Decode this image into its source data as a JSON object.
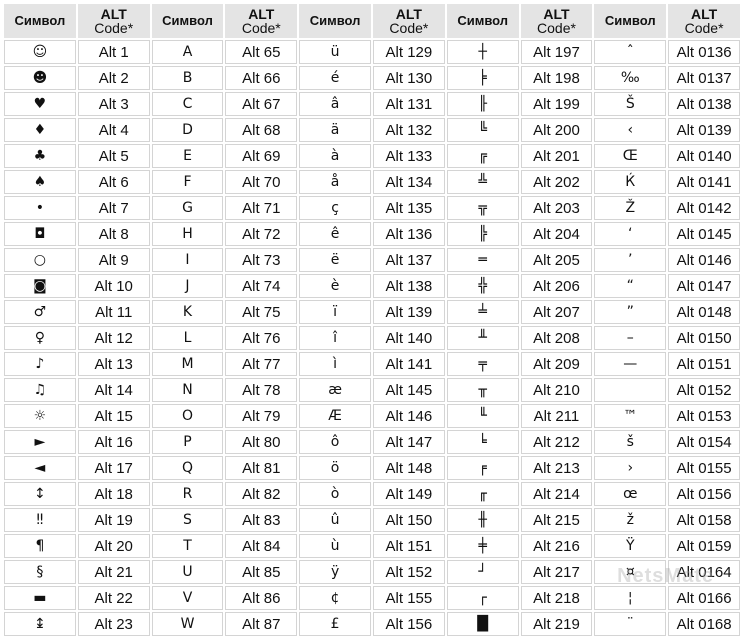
{
  "headers": {
    "symbol": "Символ",
    "code_line1": "ALT",
    "code_line2": "Code*"
  },
  "groups": [
    {
      "rows": [
        {
          "symbol": "☺",
          "code": "Alt 1"
        },
        {
          "symbol": "☻",
          "code": "Alt 2"
        },
        {
          "symbol": "♥",
          "code": "Alt 3"
        },
        {
          "symbol": "♦",
          "code": "Alt 4"
        },
        {
          "symbol": "♣",
          "code": "Alt 5"
        },
        {
          "symbol": "♠",
          "code": "Alt 6"
        },
        {
          "symbol": "•",
          "code": "Alt 7"
        },
        {
          "symbol": "◘",
          "code": "Alt 8"
        },
        {
          "symbol": "○",
          "code": "Alt 9"
        },
        {
          "symbol": "◙",
          "code": "Alt 10"
        },
        {
          "symbol": "♂",
          "code": "Alt 11"
        },
        {
          "symbol": "♀",
          "code": "Alt 12"
        },
        {
          "symbol": "♪",
          "code": "Alt 13"
        },
        {
          "symbol": "♫",
          "code": "Alt 14"
        },
        {
          "symbol": "☼",
          "code": "Alt 15"
        },
        {
          "symbol": "►",
          "code": "Alt 16"
        },
        {
          "symbol": "◄",
          "code": "Alt 17"
        },
        {
          "symbol": "↕",
          "code": "Alt 18"
        },
        {
          "symbol": "‼",
          "code": "Alt 19"
        },
        {
          "symbol": "¶",
          "code": "Alt 20"
        },
        {
          "symbol": "§",
          "code": "Alt 21"
        },
        {
          "symbol": "▬",
          "code": "Alt 22"
        },
        {
          "symbol": "↨",
          "code": "Alt 23"
        }
      ]
    },
    {
      "rows": [
        {
          "symbol": "A",
          "code": "Alt 65"
        },
        {
          "symbol": "B",
          "code": "Alt 66"
        },
        {
          "symbol": "C",
          "code": "Alt 67"
        },
        {
          "symbol": "D",
          "code": "Alt 68"
        },
        {
          "symbol": "E",
          "code": "Alt 69"
        },
        {
          "symbol": "F",
          "code": "Alt 70"
        },
        {
          "symbol": "G",
          "code": "Alt 71"
        },
        {
          "symbol": "H",
          "code": "Alt 72"
        },
        {
          "symbol": "I",
          "code": "Alt 73"
        },
        {
          "symbol": "J",
          "code": "Alt 74"
        },
        {
          "symbol": "K",
          "code": "Alt 75"
        },
        {
          "symbol": "L",
          "code": "Alt 76"
        },
        {
          "symbol": "M",
          "code": "Alt 77"
        },
        {
          "symbol": "N",
          "code": "Alt 78"
        },
        {
          "symbol": "O",
          "code": "Alt 79"
        },
        {
          "symbol": "P",
          "code": "Alt 80"
        },
        {
          "symbol": "Q",
          "code": "Alt 81"
        },
        {
          "symbol": "R",
          "code": "Alt 82"
        },
        {
          "symbol": "S",
          "code": "Alt 83"
        },
        {
          "symbol": "T",
          "code": "Alt 84"
        },
        {
          "symbol": "U",
          "code": "Alt 85"
        },
        {
          "symbol": "V",
          "code": "Alt 86"
        },
        {
          "symbol": "W",
          "code": "Alt 87"
        }
      ]
    },
    {
      "rows": [
        {
          "symbol": "ü",
          "code": "Alt 129"
        },
        {
          "symbol": "é",
          "code": "Alt 130"
        },
        {
          "symbol": "â",
          "code": "Alt 131"
        },
        {
          "symbol": "ä",
          "code": "Alt 132"
        },
        {
          "symbol": "à",
          "code": "Alt 133"
        },
        {
          "symbol": "å",
          "code": "Alt 134"
        },
        {
          "symbol": "ç",
          "code": "Alt 135"
        },
        {
          "symbol": "ê",
          "code": "Alt 136"
        },
        {
          "symbol": "ë",
          "code": "Alt 137"
        },
        {
          "symbol": "è",
          "code": "Alt 138"
        },
        {
          "symbol": "ï",
          "code": "Alt 139"
        },
        {
          "symbol": "î",
          "code": "Alt 140"
        },
        {
          "symbol": "ì",
          "code": "Alt 141"
        },
        {
          "symbol": "æ",
          "code": "Alt 145"
        },
        {
          "symbol": "Æ",
          "code": "Alt 146"
        },
        {
          "symbol": "ô",
          "code": "Alt 147"
        },
        {
          "symbol": "ö",
          "code": "Alt 148"
        },
        {
          "symbol": "ò",
          "code": "Alt 149"
        },
        {
          "symbol": "û",
          "code": "Alt 150"
        },
        {
          "symbol": "ù",
          "code": "Alt 151"
        },
        {
          "symbol": "ÿ",
          "code": "Alt 152"
        },
        {
          "symbol": "¢",
          "code": "Alt 155"
        },
        {
          "symbol": "£",
          "code": "Alt 156"
        }
      ]
    },
    {
      "rows": [
        {
          "symbol": "┼",
          "code": "Alt 197"
        },
        {
          "symbol": "╞",
          "code": "Alt 198"
        },
        {
          "symbol": "╟",
          "code": "Alt 199"
        },
        {
          "symbol": "╚",
          "code": "Alt 200"
        },
        {
          "symbol": "╔",
          "code": "Alt 201"
        },
        {
          "symbol": "╩",
          "code": "Alt 202"
        },
        {
          "symbol": "╦",
          "code": "Alt 203"
        },
        {
          "symbol": "╠",
          "code": "Alt 204"
        },
        {
          "symbol": "═",
          "code": "Alt 205"
        },
        {
          "symbol": "╬",
          "code": "Alt 206"
        },
        {
          "symbol": "╧",
          "code": "Alt 207"
        },
        {
          "symbol": "╨",
          "code": "Alt 208"
        },
        {
          "symbol": "╤",
          "code": "Alt 209"
        },
        {
          "symbol": "╥",
          "code": "Alt 210"
        },
        {
          "symbol": "╙",
          "code": "Alt 211"
        },
        {
          "symbol": "╘",
          "code": "Alt 212"
        },
        {
          "symbol": "╒",
          "code": "Alt 213"
        },
        {
          "symbol": "╓",
          "code": "Alt 214"
        },
        {
          "symbol": "╫",
          "code": "Alt 215"
        },
        {
          "symbol": "╪",
          "code": "Alt 216"
        },
        {
          "symbol": "┘",
          "code": "Alt 217"
        },
        {
          "symbol": "┌",
          "code": "Alt 218"
        },
        {
          "symbol": "█",
          "code": "Alt 219"
        }
      ]
    },
    {
      "rows": [
        {
          "symbol": "ˆ",
          "code": "Alt 0136"
        },
        {
          "symbol": "‰",
          "code": "Alt 0137"
        },
        {
          "symbol": "Š",
          "code": "Alt 0138"
        },
        {
          "symbol": "‹",
          "code": "Alt 0139"
        },
        {
          "symbol": "Œ",
          "code": "Alt 0140"
        },
        {
          "symbol": "Ќ",
          "code": "Alt 0141"
        },
        {
          "symbol": "Ž",
          "code": "Alt 0142"
        },
        {
          "symbol": "‘",
          "code": "Alt 0145"
        },
        {
          "symbol": "’",
          "code": "Alt 0146"
        },
        {
          "symbol": "“",
          "code": "Alt 0147"
        },
        {
          "symbol": "”",
          "code": "Alt 0148"
        },
        {
          "symbol": "–",
          "code": "Alt 0150"
        },
        {
          "symbol": "—",
          "code": "Alt 0151"
        },
        {
          "symbol": "",
          "code": "Alt 0152"
        },
        {
          "symbol": "™",
          "code": "Alt 0153"
        },
        {
          "symbol": "š",
          "code": "Alt 0154"
        },
        {
          "symbol": "›",
          "code": "Alt 0155"
        },
        {
          "symbol": "œ",
          "code": "Alt 0156"
        },
        {
          "symbol": "ž",
          "code": "Alt 0158"
        },
        {
          "symbol": "Ÿ",
          "code": "Alt 0159"
        },
        {
          "symbol": "¤",
          "code": "Alt 0164"
        },
        {
          "symbol": "¦",
          "code": "Alt 0166"
        },
        {
          "symbol": "¨",
          "code": "Alt 0168"
        }
      ]
    }
  ],
  "watermark": "NetsMate"
}
